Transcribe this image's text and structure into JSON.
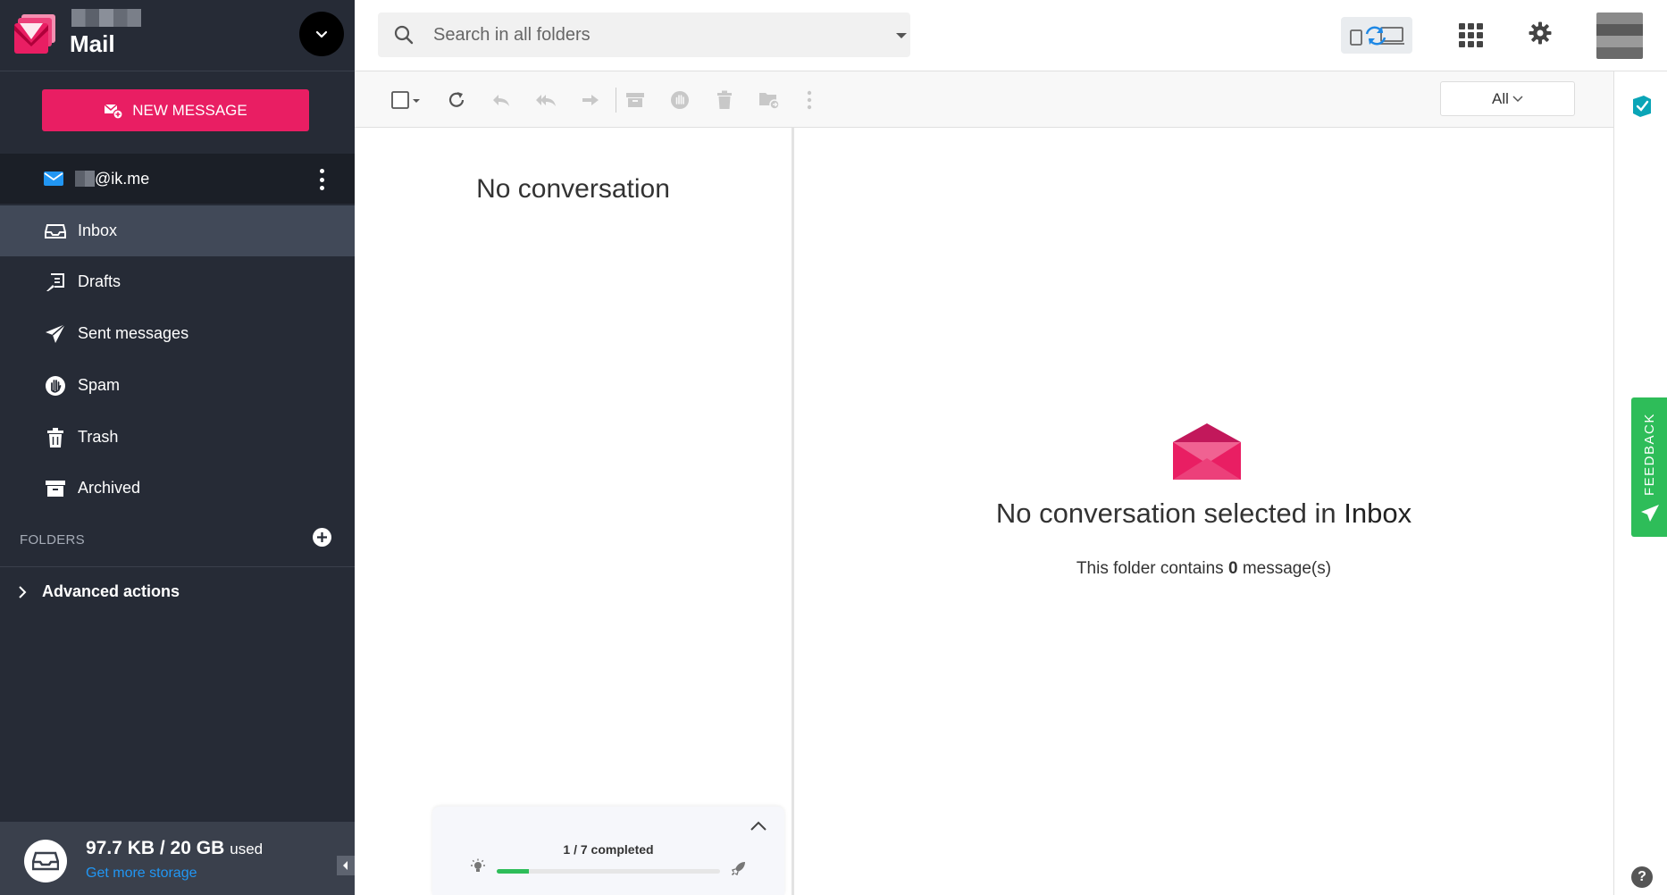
{
  "app": {
    "title": "Mail"
  },
  "sidebar": {
    "new_message_label": "NEW MESSAGE",
    "account_email": "@ik.me",
    "items": [
      {
        "label": "Inbox",
        "icon": "inbox-icon",
        "active": true
      },
      {
        "label": "Drafts",
        "icon": "drafts-icon"
      },
      {
        "label": "Sent messages",
        "icon": "send-icon"
      },
      {
        "label": "Spam",
        "icon": "spam-hand-icon"
      },
      {
        "label": "Trash",
        "icon": "trash-icon"
      },
      {
        "label": "Archived",
        "icon": "archive-icon"
      }
    ],
    "folders_label": "FOLDERS",
    "advanced_actions_label": "Advanced actions",
    "storage": {
      "used": "97.7 KB / 20 GB",
      "used_suffix": "used",
      "link": "Get more storage"
    }
  },
  "search": {
    "placeholder": "Search in all folders"
  },
  "toolbar": {
    "filter_label": "All"
  },
  "list": {
    "empty_text": "No conversation"
  },
  "reading": {
    "empty_prefix": "No conversation selected in",
    "folder_name": "Inbox",
    "contains_prefix": "This folder contains",
    "message_count": "0",
    "contains_suffix": "message(s)"
  },
  "tasks": {
    "progress_text": "1 / 7 completed",
    "progress_fraction": 0.143
  },
  "feedback": {
    "label": "FEEDBACK"
  },
  "help": {
    "label": "?"
  },
  "colors": {
    "accent": "#e91e63",
    "sidebar": "#262b36",
    "link": "#2196f3",
    "feedback": "#2ebd59",
    "mail_icon": "#2196f3"
  }
}
